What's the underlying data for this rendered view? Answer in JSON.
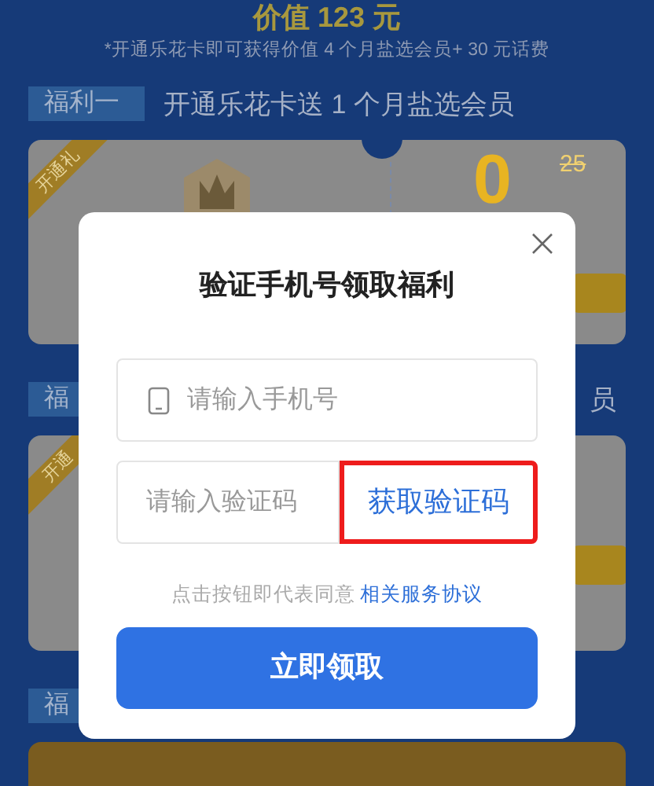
{
  "page": {
    "headline": "价值 123 元",
    "subtitle": "*开通乐花卡即可获得价值 4 个月盐选会员+ 30 元话费",
    "sections": [
      {
        "tag": "福利一",
        "title": "开通乐花卡送 1 个月盐选会员",
        "card": {
          "ribbon": "开通礼",
          "price": "0",
          "original_price": "25"
        }
      },
      {
        "tag": "福",
        "title": "员",
        "card": {
          "ribbon": "开通"
        }
      },
      {
        "tag": "福"
      }
    ]
  },
  "dialog": {
    "title": "验证手机号领取福利",
    "phone_field": {
      "placeholder": "请输入手机号"
    },
    "code_field": {
      "placeholder": "请输入验证码"
    },
    "code_button": {
      "label": "获取验证码",
      "highlighted": true
    },
    "agreement": {
      "text": "点击按钮即代表同意",
      "link": "相关服务协议"
    },
    "submit_button": "立即领取"
  }
}
